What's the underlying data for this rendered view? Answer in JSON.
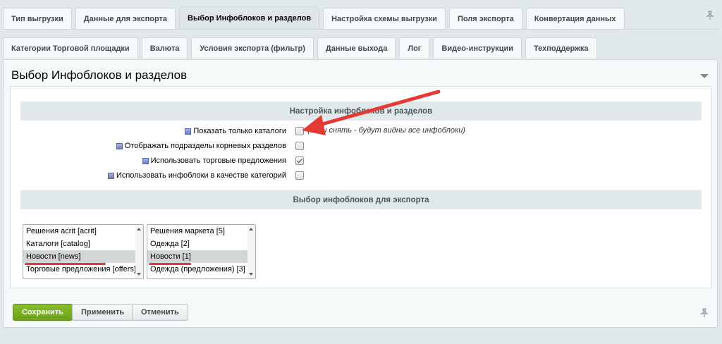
{
  "tabs_row1": [
    {
      "label": "Тип выгрузки",
      "active": false
    },
    {
      "label": "Данные для экспорта",
      "active": false
    },
    {
      "label": "Выбор Инфоблоков и разделов",
      "active": true
    },
    {
      "label": "Настройка схемы выгрузки",
      "active": false
    },
    {
      "label": "Поля экспорта",
      "active": false
    },
    {
      "label": "Конвертация данных",
      "active": false
    }
  ],
  "tabs_row2": [
    {
      "label": "Категории Торговой площадки"
    },
    {
      "label": "Валюта"
    },
    {
      "label": "Условия экспорта (фильтр)"
    },
    {
      "label": "Данные выхода"
    },
    {
      "label": "Лог"
    },
    {
      "label": "Видео-инструкции"
    },
    {
      "label": "Техподдержка"
    }
  ],
  "panel": {
    "title": "Выбор Инфоблоков и разделов",
    "section1": "Настройка инфоблоков и разделов",
    "section2": "Выбор инфоблоков для экспорта"
  },
  "options": [
    {
      "label": "Показать только каталоги",
      "checked": false,
      "hint": "(если снять - будут видны все инфоблоки)"
    },
    {
      "label": "Отображать подразделы корневых разделов",
      "checked": false
    },
    {
      "label": "Использовать торговые предложения",
      "checked": true
    },
    {
      "label": "Использовать инфоблоки в качестве категорий",
      "checked": false
    }
  ],
  "list_left": [
    {
      "label": "Решения acrit [acrit]",
      "selected": false
    },
    {
      "label": "Каталоги [catalog]",
      "selected": false
    },
    {
      "label": "Новости [news]",
      "selected": true
    },
    {
      "label": "Торговые предложения [offers]",
      "selected": false
    }
  ],
  "list_right": [
    {
      "label": "Решения маркета [5]",
      "selected": false
    },
    {
      "label": "Одежда [2]",
      "selected": false
    },
    {
      "label": "Новости [1]",
      "selected": true
    },
    {
      "label": "Одежда (предложения) [3]",
      "selected": false
    }
  ],
  "buttons": {
    "save": "Сохранить",
    "apply": "Применить",
    "cancel": "Отменить"
  },
  "colors": {
    "save_button": "#7ab01f",
    "annotation": "#e53935"
  }
}
